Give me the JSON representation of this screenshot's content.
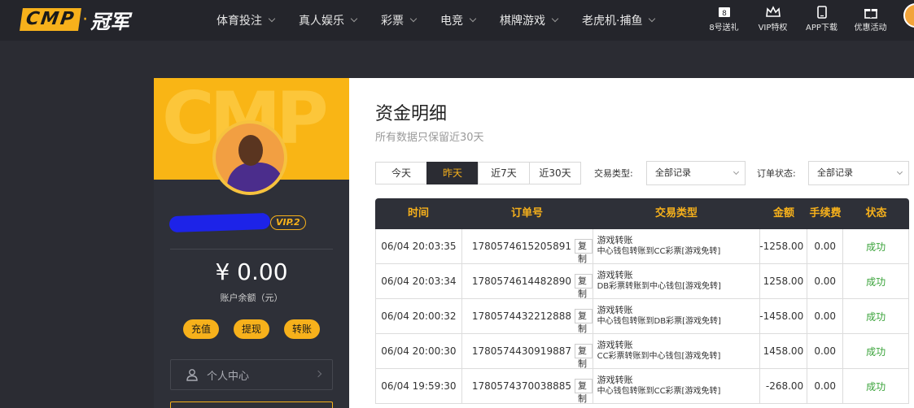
{
  "brand": {
    "logo_text": "CMP",
    "logo_cn": "冠军"
  },
  "nav": [
    {
      "label": "体育投注"
    },
    {
      "label": "真人娱乐"
    },
    {
      "label": "彩票"
    },
    {
      "label": "电竞"
    },
    {
      "label": "棋牌游戏"
    },
    {
      "label": "老虎机·捕鱼"
    }
  ],
  "top_actions": [
    {
      "label": "8号送礼",
      "icon": "ticket-icon"
    },
    {
      "label": "VIP特权",
      "icon": "crown-icon"
    },
    {
      "label": "APP下载",
      "icon": "phone-icon"
    },
    {
      "label": "优惠活动",
      "icon": "gift-icon"
    }
  ],
  "profile": {
    "banner_text": "CMP",
    "vip_level": "VIP.2",
    "balance": "¥ 0.00",
    "balance_label": "账户余额（元）",
    "actions": {
      "deposit": "充值",
      "withdraw": "提现",
      "transfer": "转账"
    },
    "menu": {
      "personal_center": "个人中心"
    }
  },
  "page": {
    "title": "资金明细",
    "subtitle": "所有数据只保留近30天",
    "tabs": [
      {
        "label": "今天"
      },
      {
        "label": "昨天"
      },
      {
        "label": "近7天"
      },
      {
        "label": "近30天"
      }
    ],
    "filters": {
      "type_label": "交易类型:",
      "type_value": "全部记录",
      "status_label": "订单状态:",
      "status_value": "全部记录"
    }
  },
  "table": {
    "headers": {
      "time": "时间",
      "order": "订单号",
      "type": "交易类型",
      "amount": "金额",
      "fee": "手续费",
      "status": "状态"
    },
    "copy_label": "复制",
    "rows": [
      {
        "time": "06/04 20:03:35",
        "order": "1780574615205891",
        "type": "游戏转账",
        "desc": "中心钱包转账到CC彩票[游戏免转]",
        "amount": "-1258.00",
        "fee": "0.00",
        "status": "成功"
      },
      {
        "time": "06/04 20:03:34",
        "order": "1780574614482890",
        "type": "游戏转账",
        "desc": "DB彩票转账到中心钱包[游戏免转]",
        "amount": "1258.00",
        "fee": "0.00",
        "status": "成功"
      },
      {
        "time": "06/04 20:00:32",
        "order": "1780574432212888",
        "type": "游戏转账",
        "desc": "中心钱包转账到DB彩票[游戏免转]",
        "amount": "-1458.00",
        "fee": "0.00",
        "status": "成功"
      },
      {
        "time": "06/04 20:00:30",
        "order": "1780574430919887",
        "type": "游戏转账",
        "desc": "CC彩票转账到中心钱包[游戏免转]",
        "amount": "1458.00",
        "fee": "0.00",
        "status": "成功"
      },
      {
        "time": "06/04 19:59:30",
        "order": "1780574370038885",
        "type": "游戏转账",
        "desc": "中心钱包转账到CC彩票[游戏免转]",
        "amount": "-268.00",
        "fee": "0.00",
        "status": "成功"
      }
    ]
  },
  "colors": {
    "accent": "#f7b11b",
    "dark_bg": "#2b2c33",
    "success": "#3aa33a"
  }
}
